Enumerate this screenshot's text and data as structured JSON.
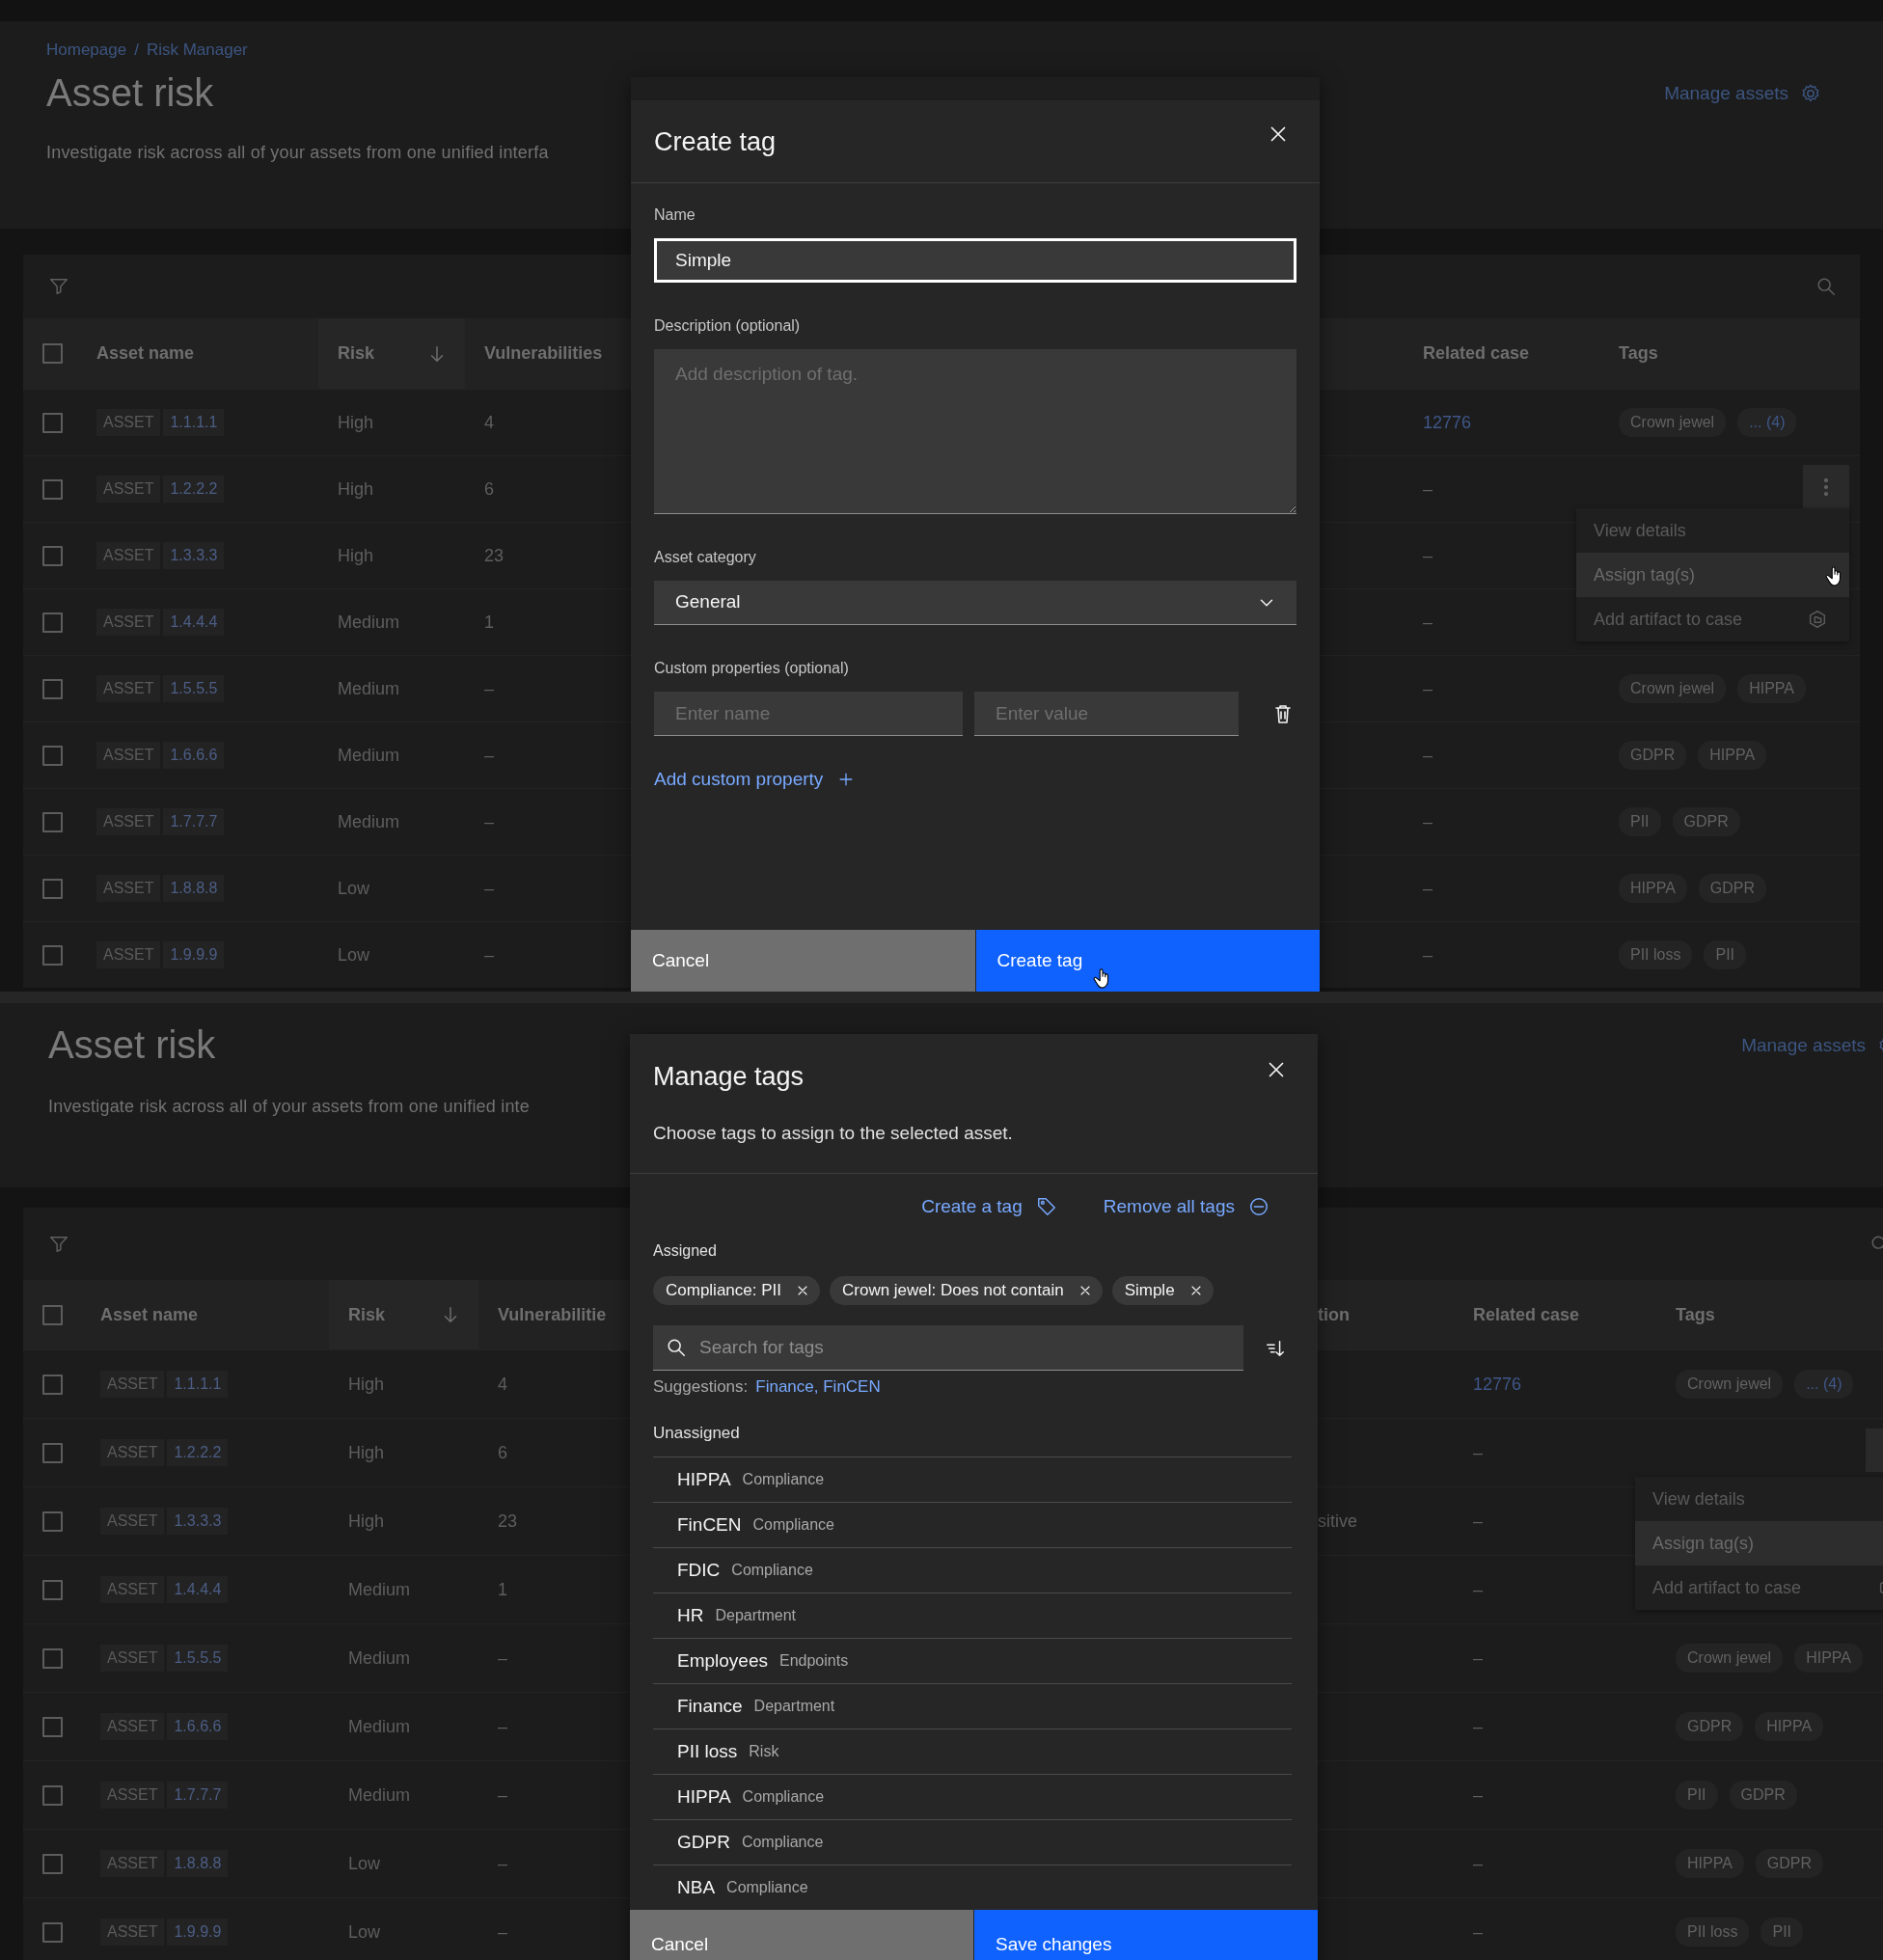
{
  "screens": [
    {
      "header": {
        "breadcrumbs": [
          "Homepage",
          "Risk Manager"
        ],
        "breadcrumb_separator": "/",
        "title": "Asset risk",
        "description": "Investigate risk across all of your assets from one unified interfa",
        "action": "Manage assets"
      },
      "table": {
        "select_all_checked": false,
        "columns": [
          {
            "kind": "asset",
            "label": "Asset name",
            "sorted": false
          },
          {
            "kind": "risk",
            "label": "Risk",
            "sorted": true
          },
          {
            "kind": "vulnerabilities",
            "label": "Vulnerabilities",
            "sorted": false
          },
          {
            "kind": "related_case",
            "label": "Related case",
            "sorted": false
          },
          {
            "kind": "tags",
            "label": "Tags",
            "sorted": false
          }
        ],
        "rows": [
          {
            "checked": false,
            "asset_type": "ASSET",
            "asset_id": "1.1.1.1",
            "risk": "High",
            "vulnerabilities": "4",
            "related_case": "12776",
            "related_case_linked": true,
            "tags": [
              "Crown jewel"
            ],
            "more_tags": "... (4)",
            "menu_open": false
          },
          {
            "checked": false,
            "asset_type": "ASSET",
            "asset_id": "1.2.2.2",
            "risk": "High",
            "vulnerabilities": "6",
            "related_case": "–",
            "related_case_linked": false,
            "tags": [],
            "menu_open": true
          },
          {
            "checked": false,
            "asset_type": "ASSET",
            "asset_id": "1.3.3.3",
            "risk": "High",
            "vulnerabilities": "23",
            "related_case": "–",
            "related_case_linked": false,
            "tags": [],
            "menu_open": false
          },
          {
            "checked": false,
            "asset_type": "ASSET",
            "asset_id": "1.4.4.4",
            "risk": "Medium",
            "vulnerabilities": "1",
            "related_case": "–",
            "related_case_linked": false,
            "tags": [],
            "menu_open": false
          },
          {
            "checked": false,
            "asset_type": "ASSET",
            "asset_id": "1.5.5.5",
            "risk": "Medium",
            "vulnerabilities": "–",
            "related_case": "–",
            "related_case_linked": false,
            "tags": [
              "Crown jewel",
              "HIPPA"
            ],
            "menu_open": false
          },
          {
            "checked": false,
            "asset_type": "ASSET",
            "asset_id": "1.6.6.6",
            "risk": "Medium",
            "vulnerabilities": "–",
            "related_case": "–",
            "related_case_linked": false,
            "tags": [
              "GDPR",
              "HIPPA"
            ],
            "menu_open": false
          },
          {
            "checked": false,
            "asset_type": "ASSET",
            "asset_id": "1.7.7.7",
            "risk": "Medium",
            "vulnerabilities": "–",
            "related_case": "–",
            "related_case_linked": false,
            "tags": [
              "PII",
              "GDPR"
            ],
            "menu_open": false
          },
          {
            "checked": false,
            "asset_type": "ASSET",
            "asset_id": "1.8.8.8",
            "risk": "Low",
            "vulnerabilities": "–",
            "related_case": "–",
            "related_case_linked": false,
            "tags": [
              "HIPPA",
              "GDPR"
            ],
            "menu_open": false
          },
          {
            "checked": false,
            "asset_type": "ASSET",
            "asset_id": "1.9.9.9",
            "risk": "Low",
            "vulnerabilities": "–",
            "related_case": "–",
            "related_case_linked": false,
            "tags": [
              "PII loss",
              "PII"
            ],
            "menu_open": false
          }
        ]
      },
      "row_menu": [
        {
          "label": "View details",
          "hovered": false
        },
        {
          "label": "Assign tag(s)",
          "hovered": true
        },
        {
          "label": "Add artifact to case",
          "hovered": false
        }
      ],
      "modal": {
        "kind": "create_tag",
        "title": "Create tag",
        "name": {
          "label": "Name",
          "value": "Simple"
        },
        "description": {
          "label": "Description (optional)",
          "placeholder": "Add description of tag."
        },
        "category": {
          "label": "Asset category",
          "value": "General"
        },
        "custom_properties": {
          "label": "Custom properties (optional)",
          "name_placeholder": "Enter name",
          "value_placeholder": "Enter value"
        },
        "add_link": "Add custom property",
        "buttons": [
          {
            "kind": "secondary",
            "label": "Cancel",
            "hovered": false
          },
          {
            "kind": "primary",
            "label": "Create tag",
            "hovered": true
          }
        ]
      }
    },
    {
      "header": {
        "title": "Asset risk",
        "description": "Investigate risk across all of your assets from one unified inte",
        "action": "Manage assets"
      },
      "table": {
        "select_all_checked": false,
        "columns": [
          {
            "kind": "asset",
            "label": "Asset name",
            "sorted": false
          },
          {
            "kind": "risk",
            "label": "Risk",
            "sorted": true
          },
          {
            "kind": "vulnerabilities",
            "label": "Vulnerabilitie",
            "sorted": false
          },
          {
            "kind": "column_4",
            "label": "tion",
            "sorted": false
          },
          {
            "kind": "related_case",
            "label": "Related case",
            "sorted": false
          },
          {
            "kind": "tags",
            "label": "Tags",
            "sorted": false
          }
        ],
        "rows": [
          {
            "checked": false,
            "asset_type": "ASSET",
            "asset_id": "1.1.1.1",
            "risk": "High",
            "vulnerabilities": "4",
            "related_case": "12776",
            "related_case_linked": true,
            "tags": [
              "Crown jewel"
            ],
            "more_tags": "... (4)",
            "menu_open": false
          },
          {
            "checked": false,
            "asset_type": "ASSET",
            "asset_id": "1.2.2.2",
            "risk": "High",
            "vulnerabilities": "6",
            "related_case": "–",
            "related_case_linked": false,
            "tags": [],
            "menu_open": true
          },
          {
            "checked": false,
            "asset_type": "ASSET",
            "asset_id": "1.3.3.3",
            "risk": "High",
            "vulnerabilities": "23",
            "column_4": "sitive",
            "related_case": "–",
            "related_case_linked": false,
            "tags": [],
            "menu_open": false
          },
          {
            "checked": false,
            "asset_type": "ASSET",
            "asset_id": "1.4.4.4",
            "risk": "Medium",
            "vulnerabilities": "1",
            "related_case": "–",
            "related_case_linked": false,
            "tags": [],
            "menu_open": false
          },
          {
            "checked": false,
            "asset_type": "ASSET",
            "asset_id": "1.5.5.5",
            "risk": "Medium",
            "vulnerabilities": "–",
            "related_case": "–",
            "related_case_linked": false,
            "tags": [
              "Crown jewel",
              "HIPPA"
            ],
            "menu_open": false
          },
          {
            "checked": false,
            "asset_type": "ASSET",
            "asset_id": "1.6.6.6",
            "risk": "Medium",
            "vulnerabilities": "–",
            "related_case": "–",
            "related_case_linked": false,
            "tags": [
              "GDPR",
              "HIPPA"
            ],
            "menu_open": false
          },
          {
            "checked": false,
            "asset_type": "ASSET",
            "asset_id": "1.7.7.7",
            "risk": "Medium",
            "vulnerabilities": "–",
            "related_case": "–",
            "related_case_linked": false,
            "tags": [
              "PII",
              "GDPR"
            ],
            "menu_open": false
          },
          {
            "checked": false,
            "asset_type": "ASSET",
            "asset_id": "1.8.8.8",
            "risk": "Low",
            "vulnerabilities": "–",
            "related_case": "–",
            "related_case_linked": false,
            "tags": [
              "HIPPA",
              "GDPR"
            ],
            "menu_open": false
          },
          {
            "checked": false,
            "asset_type": "ASSET",
            "asset_id": "1.9.9.9",
            "risk": "Low",
            "vulnerabilities": "–",
            "related_case": "–",
            "related_case_linked": false,
            "tags": [
              "PII loss",
              "PII"
            ],
            "menu_open": false
          }
        ]
      },
      "row_menu": [
        {
          "label": "View details",
          "hovered": false
        },
        {
          "label": "Assign tag(s)",
          "hovered": true
        },
        {
          "label": "Add artifact to case",
          "hovered": false
        }
      ],
      "modal": {
        "kind": "manage_tags",
        "title": "Manage tags",
        "subtitle": "Choose tags to assign to the selected asset.",
        "actions": [
          {
            "kind": "create",
            "label": "Create a tag"
          },
          {
            "kind": "remove",
            "label": "Remove all tags"
          }
        ],
        "assigned_label": "Assigned",
        "assigned": [
          "Compliance: PII",
          "Crown jewel: Does not contain",
          "Simple"
        ],
        "search": {
          "placeholder": "Search for tags"
        },
        "suggestions_label": "Suggestions:",
        "suggestions": "Finance, FinCEN",
        "unassigned_label": "Unassigned",
        "unassigned": [
          {
            "name": "HIPPA",
            "category": "Compliance"
          },
          {
            "name": "FinCEN",
            "category": "Compliance"
          },
          {
            "name": "FDIC",
            "category": "Compliance"
          },
          {
            "name": "HR",
            "category": "Department"
          },
          {
            "name": "Employees",
            "category": "Endpoints"
          },
          {
            "name": "Finance",
            "category": "Department"
          },
          {
            "name": "PII loss",
            "category": "Risk"
          },
          {
            "name": "HIPPA",
            "category": "Compliance"
          },
          {
            "name": "GDPR",
            "category": "Compliance"
          },
          {
            "name": "NBA",
            "category": "Compliance"
          }
        ],
        "buttons": [
          {
            "kind": "secondary",
            "label": "Cancel",
            "hovered": false
          },
          {
            "kind": "primary",
            "label": "Save changes",
            "hovered": false
          }
        ]
      }
    }
  ]
}
